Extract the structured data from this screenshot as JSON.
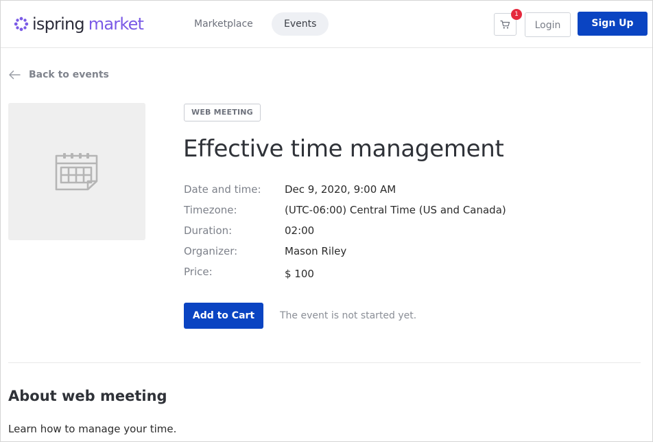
{
  "header": {
    "logo_part1": "ispring",
    "logo_part2": "market",
    "nav": {
      "marketplace": "Marketplace",
      "events": "Events"
    },
    "cart_count": "1",
    "login_label": "Login",
    "signup_label": "Sign Up"
  },
  "back_link": "Back to events",
  "event": {
    "type_badge": "WEB MEETING",
    "title": "Effective time management",
    "details": [
      {
        "label": "Date and time:",
        "value": "Dec 9, 2020, 9:00 AM"
      },
      {
        "label": "Timezone:",
        "value": "(UTC-06:00) Central Time (US and Canada)"
      },
      {
        "label": "Duration:",
        "value": "02:00"
      },
      {
        "label": "Organizer:",
        "value": "Mason Riley"
      },
      {
        "label": "Price:",
        "value": "$ 100"
      }
    ],
    "add_to_cart_label": "Add to Cart",
    "status_note": "The event is not started yet."
  },
  "about": {
    "heading": "About web meeting",
    "text": "Learn how to manage your time."
  },
  "colors": {
    "primary": "#0a44c2",
    "brand_purple": "#7a5ae6",
    "badge_red": "#e5293d"
  }
}
